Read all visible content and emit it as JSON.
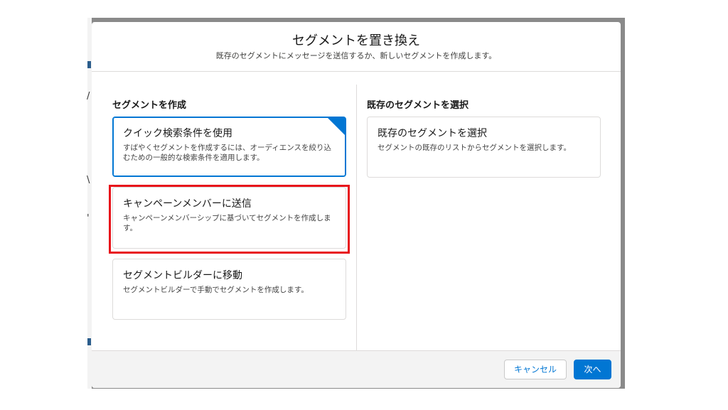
{
  "modal": {
    "title": "セグメントを置き換え",
    "subtitle": "既存のセグメントにメッセージを送信するか、新しいセグメントを作成します。"
  },
  "left_section": {
    "heading": "セグメントを作成",
    "cards": [
      {
        "title": "クイック検索条件を使用",
        "description": "すばやくセグメントを作成するには、オーディエンスを絞り込むための一般的な検索条件を適用します。",
        "selected": true
      },
      {
        "title": "キャンペーンメンバーに送信",
        "description": "キャンペーンメンバーシップに基づいてセグメントを作成します。",
        "selected": false
      },
      {
        "title": "セグメントビルダーに移動",
        "description": "セグメントビルダーで手動でセグメントを作成します。",
        "selected": false
      }
    ]
  },
  "right_section": {
    "heading": "既存のセグメントを選択",
    "cards": [
      {
        "title": "既存のセグメントを選択",
        "description": "セグメントの既存のリストからセグメントを選択します。",
        "selected": false
      }
    ]
  },
  "footer": {
    "cancel_label": "キャンセル",
    "next_label": "次へ"
  },
  "colors": {
    "brand": "#0176d3",
    "highlight": "#e8141b"
  }
}
